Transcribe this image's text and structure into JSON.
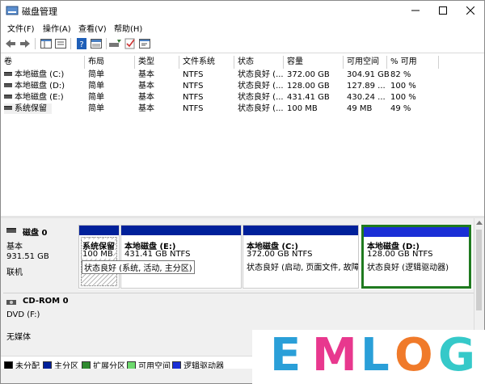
{
  "window": {
    "title": "磁盘管理"
  },
  "menu": [
    "文件(F)",
    "操作(A)",
    "查看(V)",
    "帮助(H)"
  ],
  "columns": [
    "卷",
    "布局",
    "类型",
    "文件系统",
    "状态",
    "容量",
    "可用空间",
    "% 可用"
  ],
  "volumes": [
    {
      "name": "本地磁盘 (C:)",
      "layout": "简单",
      "type": "基本",
      "fs": "NTFS",
      "status": "状态良好 (...",
      "capacity": "372.00 GB",
      "free": "304.91 GB",
      "pct": "82 %"
    },
    {
      "name": "本地磁盘 (D:)",
      "layout": "简单",
      "type": "基本",
      "fs": "NTFS",
      "status": "状态良好 (...",
      "capacity": "128.00 GB",
      "free": "127.89 ...",
      "pct": "100 %"
    },
    {
      "name": "本地磁盘 (E:)",
      "layout": "简单",
      "type": "基本",
      "fs": "NTFS",
      "status": "状态良好 (...",
      "capacity": "431.41 GB",
      "free": "430.24 ...",
      "pct": "100 %"
    },
    {
      "name": "系统保留",
      "layout": "简单",
      "type": "基本",
      "fs": "NTFS",
      "status": "状态良好 (...",
      "capacity": "100 MB",
      "free": "49 MB",
      "pct": "49 %"
    }
  ],
  "disk0": {
    "name": "磁盘 0",
    "kind": "基本",
    "size": "931.51 GB",
    "state": "联机",
    "partitions": [
      {
        "title": "系统保留",
        "size": "100 MB",
        "status": "状态良好 (系统, 活动, 主分区)"
      },
      {
        "title": "本地磁盘  (E:)",
        "size": "431.41 GB NTFS",
        "status": ""
      },
      {
        "title": "本地磁盘  (C:)",
        "size": "372.00 GB NTFS",
        "status": "状态良好 (启动, 页面文件, 故障转"
      },
      {
        "title": "本地磁盘  (D:)",
        "size": "128.00 GB NTFS",
        "status": "状态良好 (逻辑驱动器)"
      }
    ]
  },
  "cdrom": {
    "name": "CD-ROM 0",
    "kind": "DVD (F:)",
    "media": "无媒体"
  },
  "legend": [
    {
      "label": "未分配",
      "color": "#000000"
    },
    {
      "label": "主分区",
      "color": "#00209a"
    },
    {
      "label": "扩展分区",
      "color": "#2f8a2f"
    },
    {
      "label": "可用空间",
      "color": "#6ed96e"
    },
    {
      "label": "逻辑驱动器",
      "color": "#1a2fd6"
    }
  ],
  "logo": {
    "letters": [
      "E",
      "M",
      "L",
      "O",
      "G"
    ],
    "colors": [
      "#2a9fd8",
      "#e8388e",
      "#2a9fd8",
      "#f07a2a",
      "#35c9c9"
    ]
  }
}
